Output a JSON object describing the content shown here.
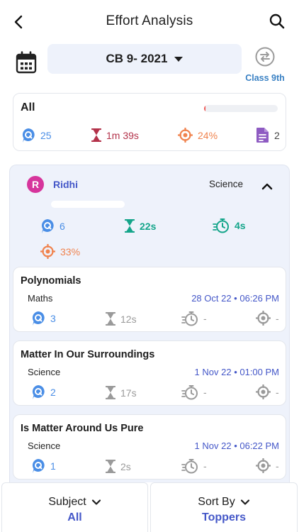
{
  "header": {
    "title": "Effort Analysis"
  },
  "batch": {
    "label": "CB 9- 2021",
    "class_label": "Class 9th"
  },
  "summary": {
    "name": "All",
    "progress": 0.02,
    "questions": "25",
    "time": "1m 39s",
    "accuracy": "24%",
    "sheets": "2"
  },
  "student": {
    "initial": "R",
    "name": "Ridhi",
    "subject": "Science",
    "progress": 0.0,
    "questions": "6",
    "time": "22s",
    "speed": "4s",
    "accuracy": "33%"
  },
  "topics": [
    {
      "name": "Polynomials",
      "subject": "Maths",
      "date": "28 Oct 22 • 06:26 PM",
      "questions": "3",
      "time": "12s",
      "speed": "-",
      "accuracy": "-"
    },
    {
      "name": "Matter In Our Surroundings",
      "subject": "Science",
      "date": "1 Nov 22 • 01:00 PM",
      "questions": "2",
      "time": "17s",
      "speed": "-",
      "accuracy": "-"
    },
    {
      "name": "Is Matter Around Us Pure",
      "subject": "Science",
      "date": "1 Nov 22 • 06:22 PM",
      "questions": "1",
      "time": "2s",
      "speed": "-",
      "accuracy": "-"
    }
  ],
  "filters": {
    "subject_title": "Subject",
    "subject_value": "All",
    "sort_title": "Sort By",
    "sort_value": "Toppers"
  },
  "colors": {
    "accent_blue": "#4457c8",
    "question_blue": "#4a8ee6",
    "time_red": "#b3324a",
    "accuracy_orange": "#f0834e",
    "sheet_purple": "#8e5bc2",
    "teal": "#14a58a",
    "muted_grey": "#9a9a9a"
  }
}
